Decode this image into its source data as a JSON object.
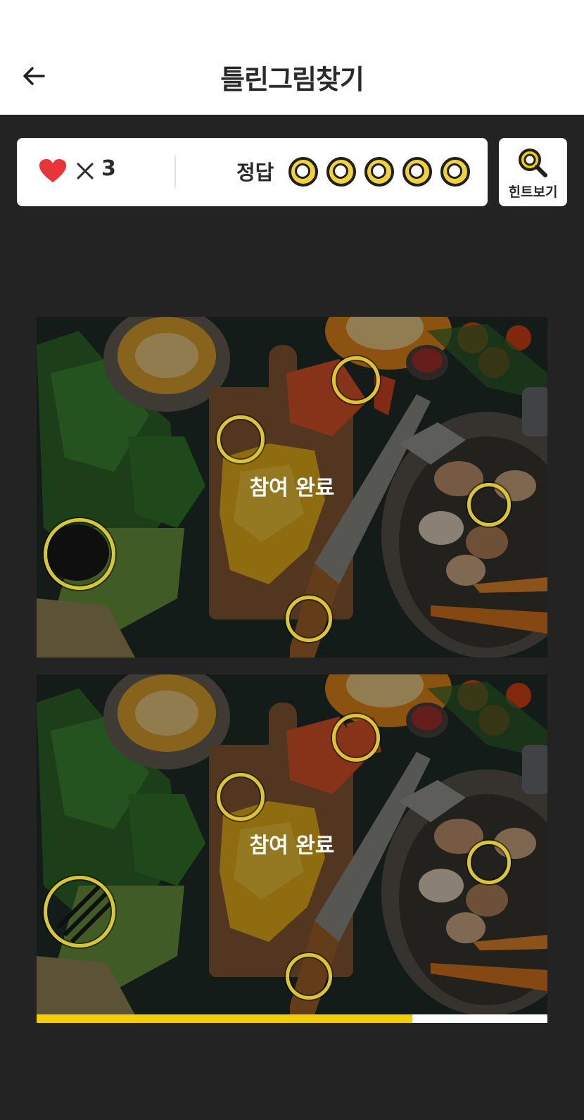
{
  "header": {
    "title": "틀린그림찾기",
    "back_icon": "back-arrow-icon"
  },
  "status": {
    "lives_icon": "heart-icon",
    "lives_prefix": "×",
    "lives_count": "3",
    "answer_label": "정답",
    "answer_slots_total": 5,
    "answer_slots_found": 5
  },
  "hint": {
    "label": "힌트보기",
    "icon": "magnifier-icon"
  },
  "puzzle": {
    "top_overlay_text": "참여 완료",
    "bottom_overlay_text": "참여 완료"
  },
  "progress": {
    "fraction": 0.735
  },
  "colors": {
    "accent": "#f2d000",
    "marker": "#d8c636",
    "heart": "#e8353a",
    "background": "#232323"
  }
}
